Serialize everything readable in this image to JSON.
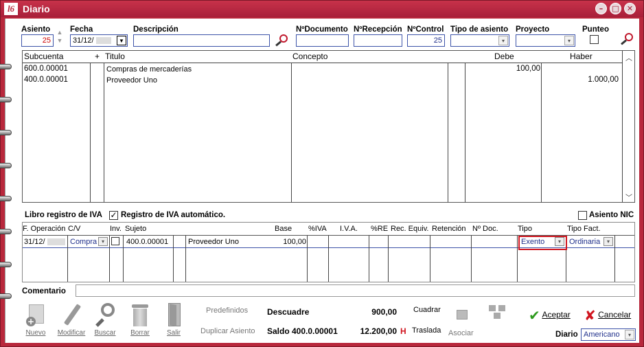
{
  "window": {
    "title": "Diario",
    "logo": "l6"
  },
  "header": {
    "asiento_label": "Asiento",
    "asiento_value": "25",
    "fecha_label": "Fecha",
    "fecha_value": "31/12/",
    "descripcion_label": "Descripción",
    "descripcion_value": "",
    "ndocumento_label": "NºDocumento",
    "ndocumento_value": "",
    "nrecepcion_label": "NºRecepción",
    "nrecepcion_value": "",
    "ncontrol_label": "NºControl",
    "ncontrol_value": "25",
    "tipo_asiento_label": "Tipo de asiento",
    "tipo_asiento_value": "",
    "proyecto_label": "Proyecto",
    "proyecto_value": "",
    "punteo_label": "Punteo",
    "punteo_checked": false
  },
  "entries_grid": {
    "columns": [
      "Subcuenta",
      "+",
      "Titulo",
      "Concepto",
      "Debe",
      "Haber"
    ],
    "rows": [
      {
        "subcuenta": "600.0.00001",
        "titulo": "Compras de mercaderías",
        "concepto": "",
        "debe": "100,00",
        "haber": ""
      },
      {
        "subcuenta": "400.0.00001",
        "titulo": "Proveedor Uno",
        "concepto": "",
        "debe": "",
        "haber": "1.000,00"
      }
    ]
  },
  "iva_section": {
    "title": "Libro registro de IVA",
    "auto_label": "Registro de IVA automático.",
    "auto_checked": true,
    "nic_label": "Asiento NIC",
    "nic_checked": false,
    "columns": [
      "F. Operación",
      "C/V",
      "Inv.",
      "Sujeto",
      "",
      "Base",
      "%IVA",
      "I.V.A.",
      "%RE",
      "Rec. Equiv.",
      "Retención",
      "Nº Doc.",
      "Tipo",
      "Tipo Fact."
    ],
    "row": {
      "f_operacion": "31/12/",
      "cv": "Compra",
      "inv": false,
      "sujeto_code": "400.0.00001",
      "sujeto_name": "Proveedor Uno",
      "base": "100,00",
      "tipo": "Exento",
      "tipo_fact": "Ordinaria"
    },
    "highlight_color": "#d0141e"
  },
  "comentario": {
    "label": "Comentario",
    "value": ""
  },
  "toolbar": {
    "nuevo": "Nuevo",
    "modificar": "Modificar",
    "buscar": "Buscar",
    "borrar": "Borrar",
    "salir": "Salir",
    "predefinidos": "Predefinidos",
    "duplicar": "Duplicar Asiento",
    "cuadrar": "Cuadrar",
    "traslada": "Traslada",
    "asociar": "Asociar"
  },
  "summary": {
    "descuadre_label": "Descuadre",
    "descuadre_value": "900,00",
    "saldo_label": "Saldo 400.0.00001",
    "saldo_value": "12.200,00",
    "saldo_side": "H"
  },
  "actions": {
    "aceptar": "Aceptar",
    "cancelar": "Cancelar"
  },
  "diario": {
    "label": "Diario",
    "value": "Americano"
  }
}
